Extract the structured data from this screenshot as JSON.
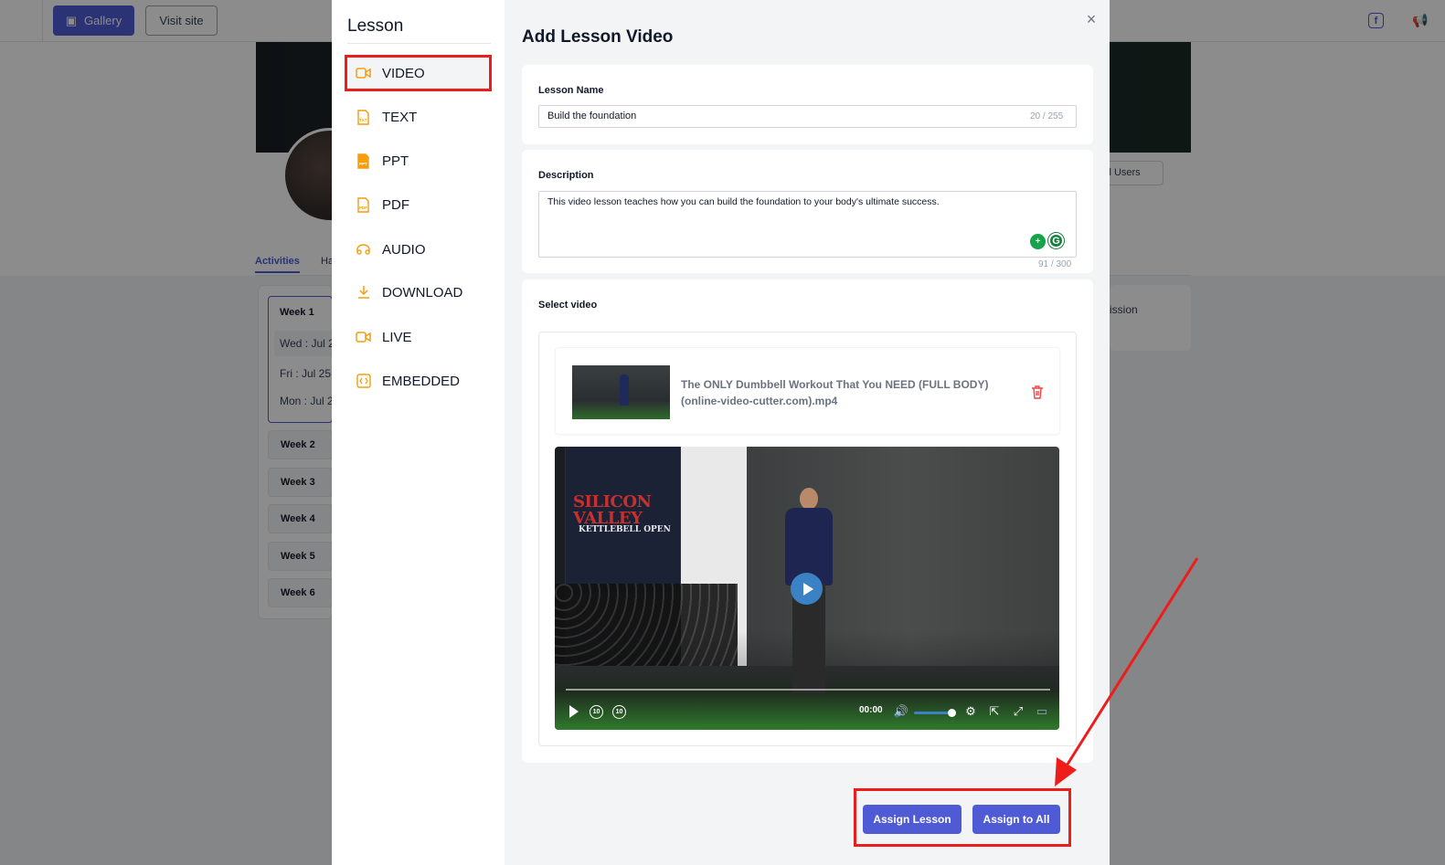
{
  "topbar": {
    "gallery_label": "Gallery",
    "visit_site_label": "Visit site"
  },
  "background": {
    "tabs": [
      "Activities",
      "Ha"
    ],
    "users_select": "ll Users",
    "right_card_text": "ission",
    "week1_label": "Week 1",
    "days": [
      "Wed : Jul 2",
      "Fri : Jul 25",
      "Mon : Jul 2"
    ],
    "weeks": [
      "Week 2",
      "Week 3",
      "Week 4",
      "Week 5",
      "Week 6"
    ]
  },
  "sidebar": {
    "title": "Lesson",
    "items": [
      {
        "label": "VIDEO",
        "icon": "video-icon",
        "glyph": "▭◂"
      },
      {
        "label": "TEXT",
        "icon": "txt-file-icon",
        "glyph": "TXT"
      },
      {
        "label": "PPT",
        "icon": "ppt-file-icon",
        "glyph": "PPT"
      },
      {
        "label": "PDF",
        "icon": "pdf-file-icon",
        "glyph": "PDF"
      },
      {
        "label": "AUDIO",
        "icon": "audio-icon",
        "glyph": "◎◎"
      },
      {
        "label": "DOWNLOAD",
        "icon": "download-icon",
        "glyph": "⤓"
      },
      {
        "label": "LIVE",
        "icon": "live-video-icon",
        "glyph": "▭◂"
      },
      {
        "label": "EMBEDDED",
        "icon": "embed-icon",
        "glyph": "<>"
      }
    ],
    "active_index": 0
  },
  "modal": {
    "title": "Add Lesson Video",
    "lesson_name": {
      "label": "Lesson Name",
      "value": "Build the foundation",
      "counter": "20 / 255"
    },
    "description": {
      "label": "Description",
      "value": "This video lesson teaches how you can build the foundation to your body's ultimate success.",
      "counter": "91 / 300"
    },
    "select_video": {
      "label": "Select video",
      "file_name_line1": "The ONLY Dumbbell Workout That You NEED (FULL BODY)",
      "file_name_line2": "(online-video-cutter.com).mp4"
    },
    "player": {
      "banner_title": "SILICON VALLEY",
      "banner_sub": "KETTLEBELL OPEN",
      "time": "00:00",
      "rewind_label": "10",
      "forward_label": "10",
      "volume_level": 0.75
    },
    "buttons": {
      "assign_lesson": "Assign Lesson",
      "assign_all": "Assign to All"
    }
  },
  "colors": {
    "accent": "#4f5bd5",
    "highlight": "#ef1c1c",
    "icon_orange": "#f59e0b"
  }
}
